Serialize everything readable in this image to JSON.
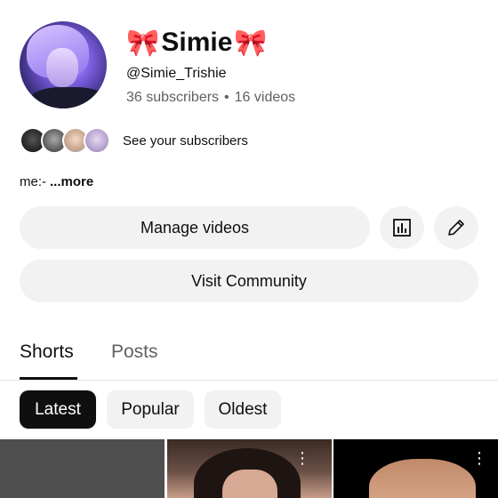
{
  "channel": {
    "name": "Simie",
    "bow_left": "🎀",
    "bow_right": "🎀",
    "handle": "@Simie_Trishie",
    "subscribers": "36 subscribers",
    "separator": "•",
    "videos": "16 videos",
    "see_subscribers": "See your subscribers",
    "description": "me:-",
    "more": "...more"
  },
  "actions": {
    "manage_videos": "Manage videos",
    "visit_community": "Visit Community",
    "analytics_icon": "analytics-icon",
    "edit_icon": "pencil-icon"
  },
  "tabs": [
    {
      "label": "Shorts",
      "active": true
    },
    {
      "label": "Posts",
      "active": false
    }
  ],
  "filters": [
    {
      "label": "Latest",
      "selected": true
    },
    {
      "label": "Popular",
      "selected": false
    },
    {
      "label": "Oldest",
      "selected": false
    }
  ],
  "thumbnail_menu_icon": "⋮"
}
